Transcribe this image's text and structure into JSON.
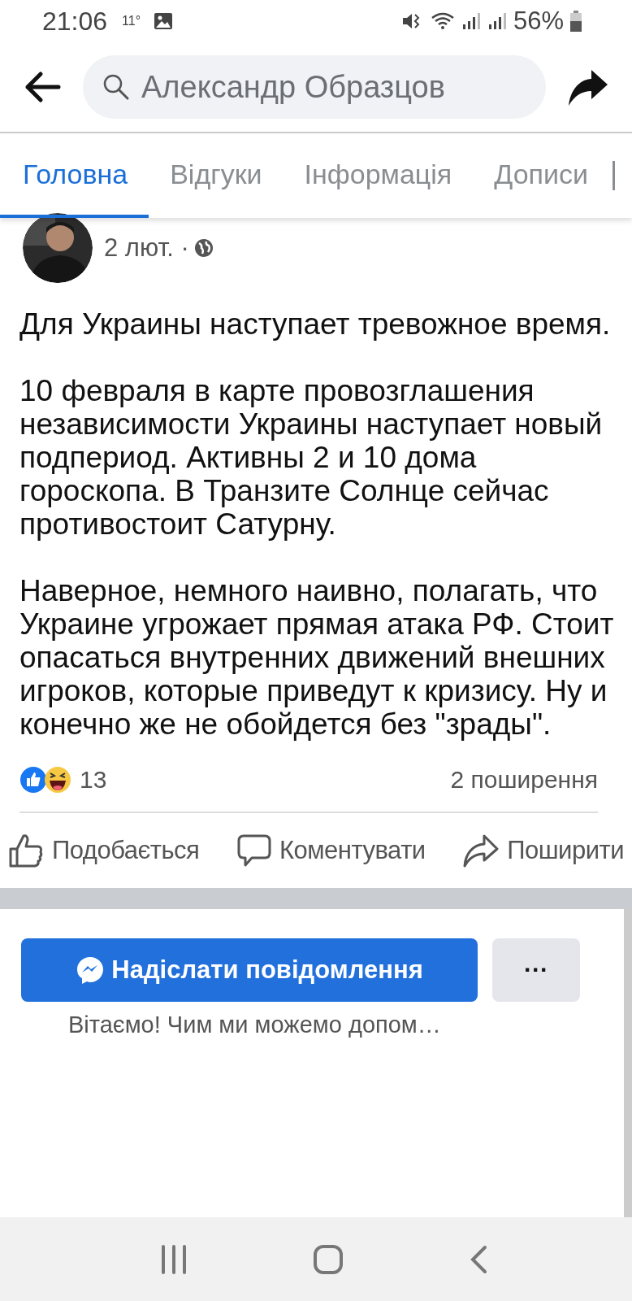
{
  "status_bar": {
    "time": "21:06",
    "temperature": "11°",
    "battery": "56%"
  },
  "header": {
    "search": {
      "value": "Александр Образцов"
    }
  },
  "tabs": [
    {
      "label": "Головна",
      "selected": true
    },
    {
      "label": "Відгуки",
      "selected": false
    },
    {
      "label": "Інформація",
      "selected": false
    },
    {
      "label": "Дописи",
      "selected": false
    }
  ],
  "post": {
    "avatar": {
      "kind": "picture"
    },
    "date": "2 лют. ·",
    "paragraphs": [
      "Для Украины наступает тревожное время.",
      "10 февраля в карте провозглашения независимости Украины наступает новый подпериод. Активны 2 и 10 дома гороскопа. В Транзите Солнце сейчас противостоит Сатурну.",
      "Наверное, немного наивно, полагать, что Украине угрожает прямая атака РФ. Стоит опасаться внутренних движений внешних игроков, которые приведут к кризису. Ну и конечно же не обойдется без \"зрады\"."
    ],
    "reaction_count": "13",
    "shares": "2 поширення",
    "actions": [
      {
        "kind": "like",
        "label": "Подобається"
      },
      {
        "kind": "comment",
        "label": "Коментувати"
      },
      {
        "kind": "share",
        "label": "Поширити"
      }
    ]
  },
  "message": {
    "button": "Надіслати повідомлення",
    "more": "···",
    "greeting": "Вітаємо! Чим ми можемо допом…"
  }
}
